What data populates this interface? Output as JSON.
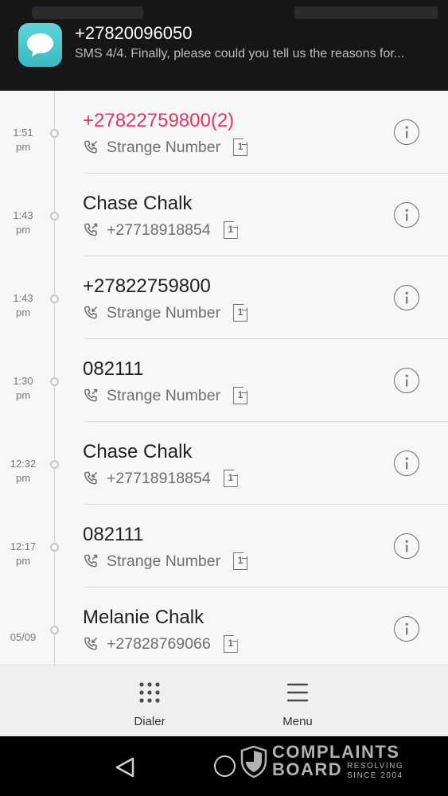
{
  "notification": {
    "icon": "sms-bubble-icon",
    "accent": "#44c2c8",
    "title": "+27820096050",
    "body": "SMS 4/4. Finally, please could you tell us the reasons for..."
  },
  "call_log": [
    {
      "time": "1:51",
      "ampm": "pm",
      "name": "+27822759800(2)",
      "missed": true,
      "call_type": "incoming-call-icon",
      "detail": "Strange Number",
      "sim": "1"
    },
    {
      "time": "1:43",
      "ampm": "pm",
      "name": "Chase Chalk",
      "missed": false,
      "call_type": "outgoing-call-icon",
      "detail": "+27718918854",
      "sim": "1"
    },
    {
      "time": "1:43",
      "ampm": "pm",
      "name": "+27822759800",
      "missed": false,
      "call_type": "incoming-call-icon",
      "detail": "Strange Number",
      "sim": "1"
    },
    {
      "time": "1:30",
      "ampm": "pm",
      "name": "082111",
      "missed": false,
      "call_type": "outgoing-call-icon",
      "detail": "Strange Number",
      "sim": "1"
    },
    {
      "time": "12:32",
      "ampm": "pm",
      "name": "Chase Chalk",
      "missed": false,
      "call_type": "incoming-call-icon",
      "detail": "+27718918854",
      "sim": "1"
    },
    {
      "time": "12:17",
      "ampm": "pm",
      "name": "082111",
      "missed": false,
      "call_type": "outgoing-call-icon",
      "detail": "Strange Number",
      "sim": "1"
    },
    {
      "time": "05/09",
      "ampm": "",
      "name": "Melanie Chalk",
      "missed": false,
      "call_type": "incoming-call-icon",
      "detail": "+27828769066",
      "sim": "1"
    }
  ],
  "bottom_bar": {
    "dialer_label": "Dialer",
    "menu_label": "Menu"
  },
  "watermark": {
    "line1": "COMPLAINTS",
    "line2": "BOARD",
    "tag1": "RESOLVING",
    "tag2": "SINCE 2004"
  },
  "colors": {
    "missed_call": "#e8335f",
    "background": "#f7f7f7"
  }
}
